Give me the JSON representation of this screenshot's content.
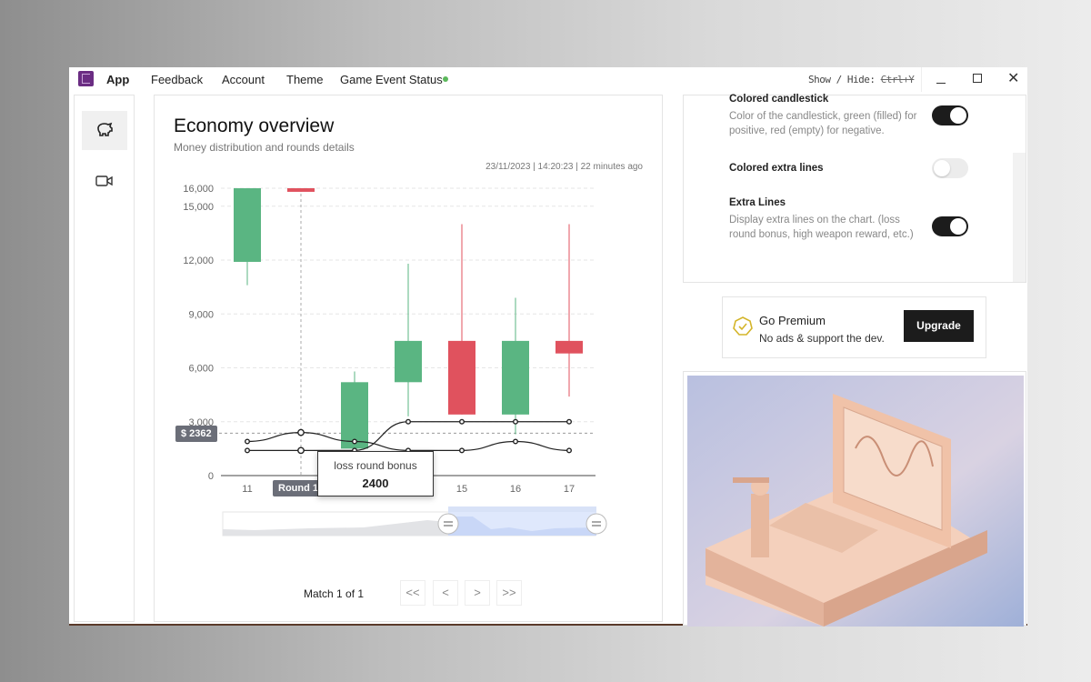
{
  "menubar": {
    "app": "App",
    "items": [
      "Feedback",
      "Account",
      "Theme",
      "Game Event Status"
    ],
    "status_color": "#5cb85c",
    "shortcut_label": "Show / Hide:",
    "shortcut_key": "Ctrl+Y"
  },
  "sidebar": {
    "items": [
      {
        "icon": "piggy-bank-icon",
        "active": true
      },
      {
        "icon": "video-camera-icon",
        "active": false
      }
    ]
  },
  "overview": {
    "title": "Economy overview",
    "subtitle": "Money distribution and rounds details",
    "timestamp": "23/11/2023 | 14:20:23 | 22 minutes ago",
    "pagination": {
      "label": "Match 1 of 1",
      "first": "<<",
      "prev": "<",
      "next": ">",
      "last": ">>"
    }
  },
  "chart_data": {
    "type": "candlestick",
    "categories": [
      "11",
      "12",
      "13",
      "14",
      "15",
      "16",
      "17"
    ],
    "candles": [
      {
        "open": 11900,
        "close": 16000,
        "low": 10600,
        "high": 16000
      },
      {
        "open": 16000,
        "close": 15800,
        "low": 15800,
        "high": 16000
      },
      {
        "open": 1500,
        "close": 5200,
        "low": 1500,
        "high": 5800
      },
      {
        "open": 5200,
        "close": 7500,
        "low": 3300,
        "high": 11800
      },
      {
        "open": 7500,
        "close": 3400,
        "low": 3400,
        "high": 14000
      },
      {
        "open": 3400,
        "close": 7500,
        "low": 2300,
        "high": 9900
      },
      {
        "open": 7500,
        "close": 6800,
        "low": 4400,
        "high": 14000
      }
    ],
    "lines": [
      {
        "name": "loss round bonus",
        "values": [
          1900,
          2400,
          1900,
          1400,
          1400,
          1900,
          1400
        ]
      },
      {
        "values": [
          1400,
          1400,
          1400,
          3000,
          3000,
          3000,
          3000
        ]
      }
    ],
    "yticks": [
      "0",
      "3,000",
      "6,000",
      "9,000",
      "12,000",
      "15,000",
      "16,000"
    ],
    "ytick_values": [
      0,
      3000,
      6000,
      9000,
      12000,
      15000,
      16000
    ],
    "ylim": [
      0,
      16000
    ],
    "grid": true,
    "colors": {
      "up": "#5ab582",
      "down": "#e0525e",
      "line": "#222222"
    },
    "crosshair": {
      "y_label": "$ 2362",
      "y_value": 2362,
      "x_label": "Round 12"
    },
    "tooltip": {
      "series": "loss round bonus",
      "value": "2400"
    }
  },
  "settings": [
    {
      "title": "Colored candlestick",
      "desc": "Color of the candlestick, green (filled) for positive, red (empty) for negative.",
      "on": true
    },
    {
      "title": "Colored extra lines",
      "desc": "",
      "on": false
    },
    {
      "title": "Extra Lines",
      "desc": "Display extra lines on the chart. (loss round bonus, high weapon reward, etc.)",
      "on": true
    }
  ],
  "premium": {
    "title": "Go Premium",
    "desc": "No ads & support the dev.",
    "button": "Upgrade",
    "accent": "#d4b52a"
  }
}
